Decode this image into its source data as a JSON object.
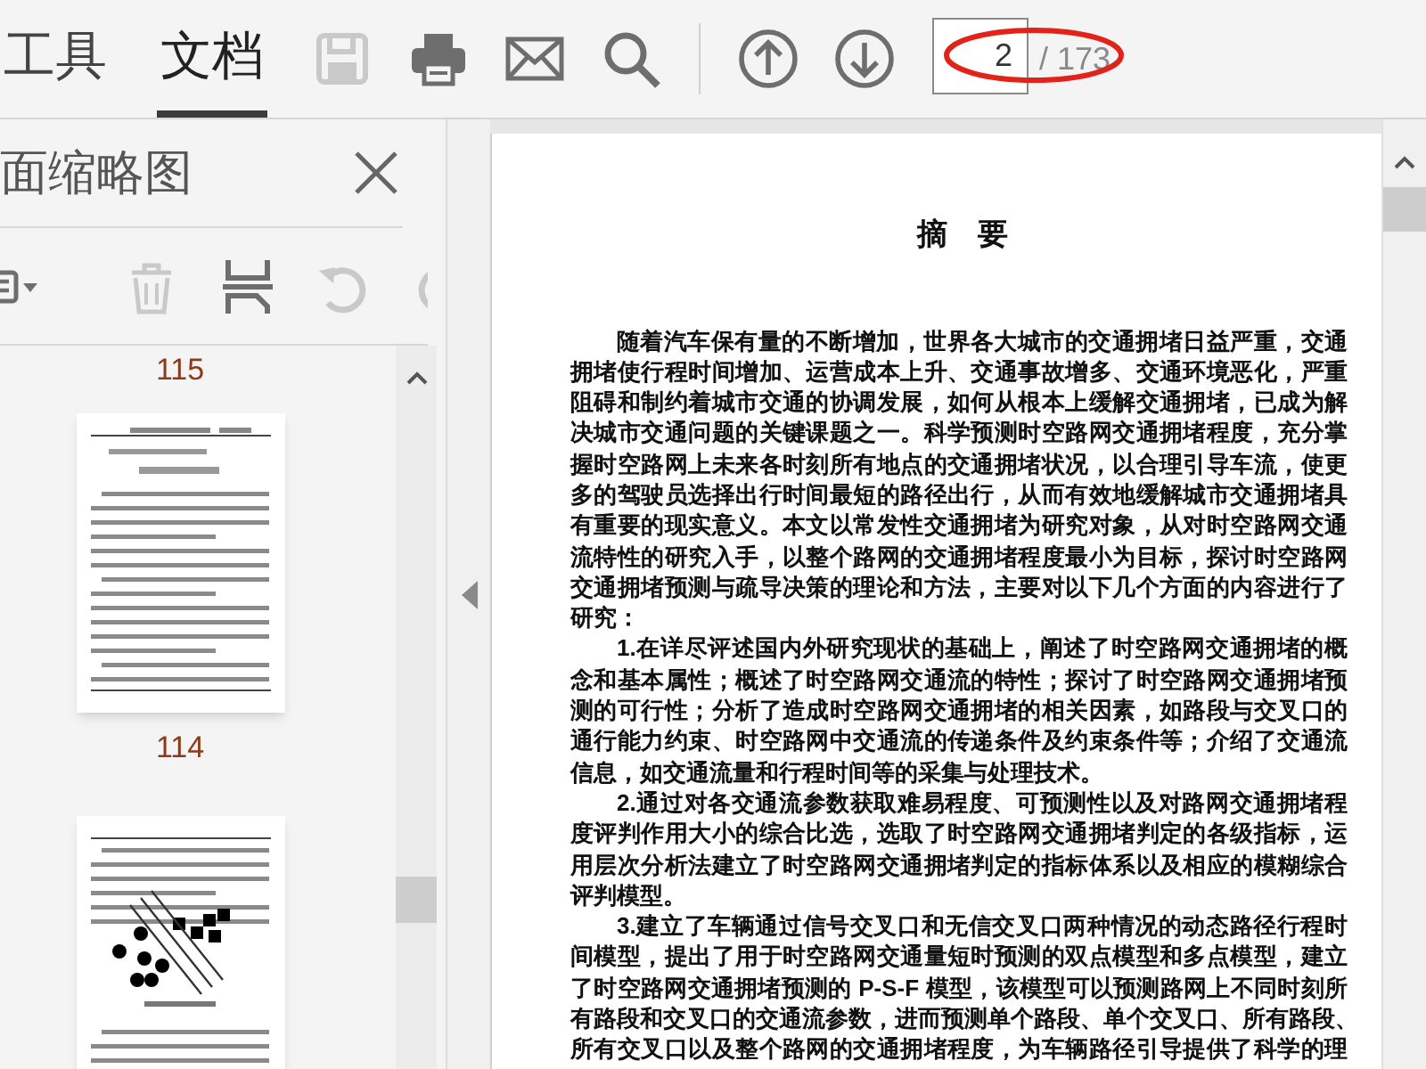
{
  "toolbar": {
    "tabs": [
      {
        "label": "工具",
        "selected": false
      },
      {
        "label": "文档",
        "selected": true
      }
    ],
    "buttons": [
      {
        "kind": "save",
        "disabled": true
      },
      {
        "kind": "print",
        "disabled": false
      },
      {
        "kind": "email",
        "disabled": false
      },
      {
        "kind": "search",
        "disabled": false
      },
      {
        "kind": "separator"
      },
      {
        "kind": "previous_page",
        "disabled": false
      },
      {
        "kind": "next_page",
        "disabled": false
      }
    ],
    "page_input": {
      "value": "2"
    },
    "page_total": "/ 173",
    "page_total_circled": true
  },
  "sidebar": {
    "title": "面缩略图",
    "tools": [
      {
        "kind": "options",
        "disabled": false
      },
      {
        "kind": "separator"
      },
      {
        "kind": "delete",
        "disabled": true
      },
      {
        "kind": "extract",
        "disabled": false
      },
      {
        "kind": "rotate_left",
        "disabled": true
      },
      {
        "kind": "rotate_right",
        "disabled": true
      }
    ],
    "thumbnails": [
      {
        "kind": "label",
        "text": "115"
      },
      {
        "kind": "page_text"
      },
      {
        "kind": "label",
        "text": "114"
      },
      {
        "kind": "page_figure"
      }
    ]
  },
  "document": {
    "title": "摘　要",
    "paragraphs": [
      {
        "lines": [
          "随着汽车保有量的不断增加，世界各大城市的交通拥堵日益严重，交通",
          "拥堵使行程时间增加、运营成本上升、交通事故增多、交通环境恶化，严重",
          "阻碍和制约着城市交通的协调发展，如何从根本上缓解交通拥堵，已成为解",
          "决城市交通问题的关键课题之一。科学预测时空路网交通拥堵程度，充分掌",
          "握时空路网上未来各时刻所有地点的交通拥堵状况，以合理引导车流，使更",
          "多的驾驶员选择出行时间最短的路径出行，从而有效地缓解城市交通拥堵具",
          "有重要的现实意义。本文以常发性交通拥堵为研究对象，从对时空路网交通",
          "流特性的研究入手，以整个路网的交通拥堵程度最小为目标，探讨时空路网",
          "交通拥堵预测与疏导决策的理论和方法，主要对以下几个方面的内容进行了",
          "研究："
        ]
      },
      {
        "lines": [
          "1.在详尽评述国内外研究现状的基础上，阐述了时空路网交通拥堵的概",
          "念和基本属性；概述了时空路网交通流的特性；探讨了时空路网交通拥堵预",
          "测的可行性；分析了造成时空路网交通拥堵的相关因素，如路段与交叉口的",
          "通行能力约束、时空路网中交通流的传递条件及约束条件等；介绍了交通流",
          "信息，如交通流量和行程时间等的采集与处理技术。"
        ]
      },
      {
        "lines": [
          "2.通过对各交通流参数获取难易程度、可预测性以及对路网交通拥堵程",
          "度评判作用大小的综合比选，选取了时空路网交通拥堵判定的各级指标，运",
          "用层次分析法建立了时空路网交通拥堵判定的指标体系以及相应的模糊综合",
          "评判模型。"
        ]
      },
      {
        "lines": [
          "3.建立了车辆通过信号交叉口和无信交叉口两种情况的动态路径行程时",
          "间模型，提出了用于时空路网交通量短时预测的双点模型和多点模型，建立",
          "了时空路网交通拥堵预测的 P-S-F 模型，该模型可以预测路网上不同时刻所",
          "有路段和交叉口的交通流参数，进而预测单个路段、单个交叉口、所有路段、",
          "所有交叉口以及整个路网的交通拥堵程度，为车辆路径引导提供了科学的理"
        ]
      }
    ]
  }
}
